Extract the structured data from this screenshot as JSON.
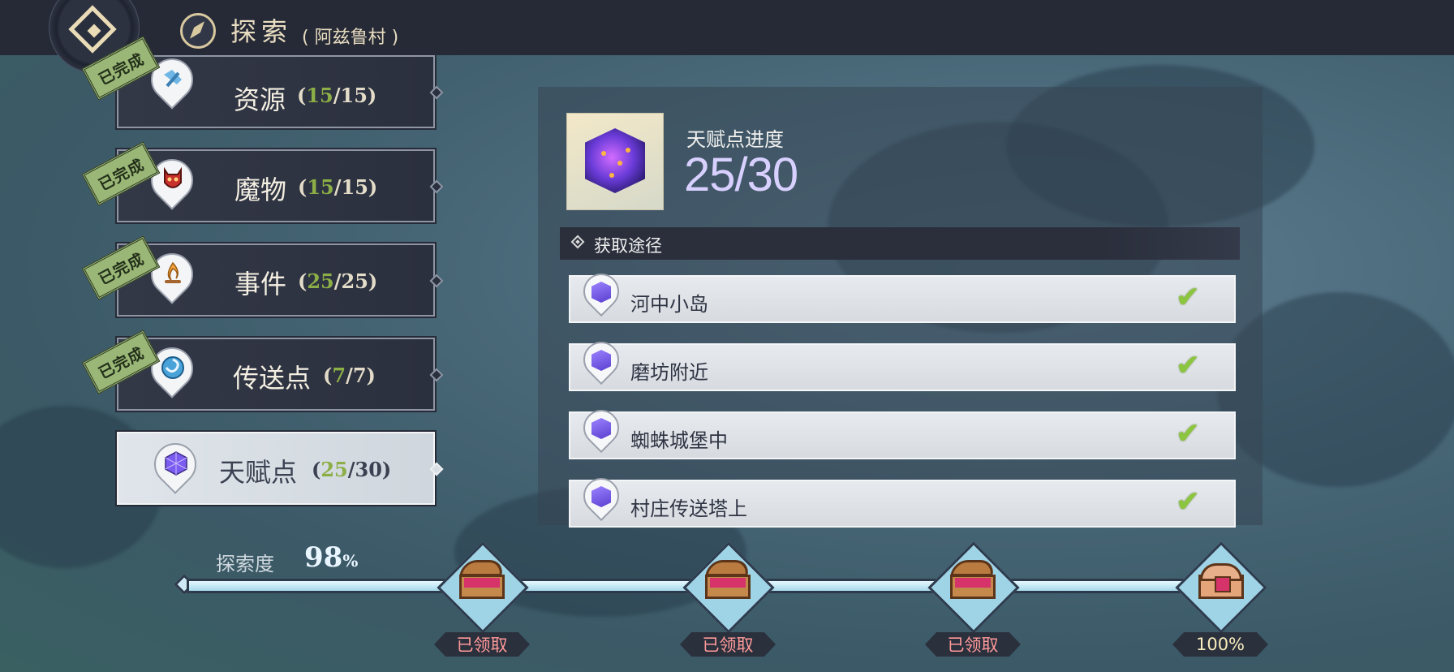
{
  "header": {
    "title": "探索",
    "subtitle": "( 阿兹鲁村 )"
  },
  "categories": [
    {
      "label": "资源",
      "done": "15",
      "total": "/15)",
      "open": "(",
      "stamp": "已完成",
      "icon": "resource-pickaxe-icon"
    },
    {
      "label": "魔物",
      "done": "15",
      "total": "/15)",
      "open": "(",
      "stamp": "已完成",
      "icon": "monster-mask-icon"
    },
    {
      "label": "事件",
      "done": "25",
      "total": "/25)",
      "open": "(",
      "stamp": "已完成",
      "icon": "event-campfire-icon"
    },
    {
      "label": "传送点",
      "done": "7",
      "total": "/7)",
      "open": "(",
      "stamp": "已完成",
      "icon": "teleport-swirl-icon"
    },
    {
      "label": "天赋点",
      "done": "25",
      "total": "/30)",
      "open": "(",
      "icon": "talent-cube-icon"
    }
  ],
  "detail": {
    "progress_label": "天赋点进度",
    "progress_value": "25/30",
    "sources_title": "获取途径",
    "locations": [
      {
        "name": "河中小岛",
        "completed": true
      },
      {
        "name": "磨坊附近",
        "completed": true
      },
      {
        "name": "蜘蛛城堡中",
        "completed": true
      },
      {
        "name": "村庄传送塔上",
        "completed": true
      }
    ]
  },
  "exploration": {
    "label": "探索度",
    "value": "98",
    "unit": "%",
    "progress_fraction": 0.98,
    "rewards": [
      {
        "status": "已领取",
        "state": "claimed"
      },
      {
        "status": "已领取",
        "state": "claimed"
      },
      {
        "status": "已领取",
        "state": "claimed"
      },
      {
        "status": "100%",
        "state": "locked"
      }
    ]
  },
  "colors": {
    "accent_green": "#8cae47",
    "claimed_red": "#ff9a9a",
    "progress_purple": "#d8d0ff"
  }
}
